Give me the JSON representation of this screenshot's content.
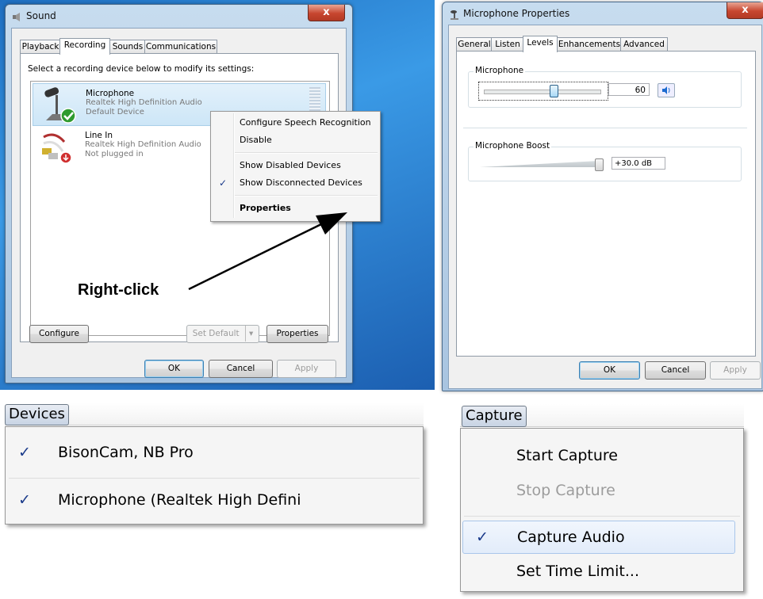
{
  "sound": {
    "title": "Sound",
    "close": "x",
    "tabs": [
      "Playback",
      "Recording",
      "Sounds",
      "Communications"
    ],
    "instruction": "Select a recording device below to modify its settings:",
    "devices": [
      {
        "name": "Microphone",
        "driver": "Realtek High Definition Audio",
        "status": "Default Device"
      },
      {
        "name": "Line In",
        "driver": "Realtek High Definition Audio",
        "status": "Not plugged in"
      }
    ],
    "buttons": {
      "configure": "Configure",
      "set_default": "Set Default",
      "properties": "Properties",
      "ok": "OK",
      "cancel": "Cancel",
      "apply": "Apply"
    }
  },
  "context_menu": {
    "items": [
      "Configure Speech Recognition",
      "Disable",
      "Show Disabled Devices",
      "Show Disconnected Devices",
      "Properties"
    ],
    "check": "✓"
  },
  "annotation": {
    "label": "Right-click"
  },
  "mic_properties": {
    "title": "Microphone Properties",
    "close": "x",
    "tabs": [
      "General",
      "Listen",
      "Levels",
      "Enhancements",
      "Advanced"
    ],
    "microphone_label": "Microphone",
    "microphone_value": "60",
    "microphone_level": 60,
    "boost_label": "Microphone Boost",
    "boost_value": "+30.0 dB",
    "boost_level": 100,
    "buttons": {
      "ok": "OK",
      "cancel": "Cancel",
      "apply": "Apply"
    }
  },
  "devices_menu": {
    "title": "Devices",
    "items": [
      "BisonCam, NB Pro",
      "Microphone (Realtek High Defini"
    ],
    "check": "✓"
  },
  "capture_menu": {
    "title": "Capture",
    "items": [
      "Start Capture",
      "Stop Capture",
      "Capture Audio",
      "Set Time Limit..."
    ],
    "check": "✓"
  },
  "colors": {
    "accent": "#3399ff",
    "selection": "#cde6f7",
    "check": "#1a3a8a"
  }
}
